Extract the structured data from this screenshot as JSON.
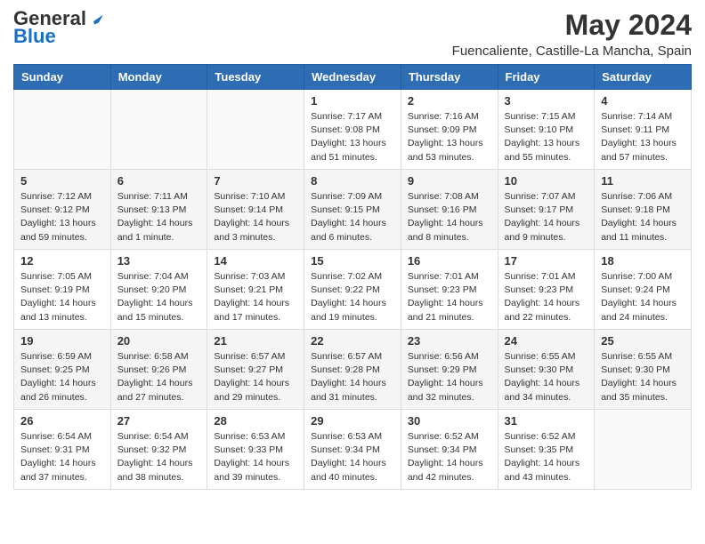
{
  "header": {
    "logo_general": "General",
    "logo_blue": "Blue",
    "title": "May 2024",
    "subtitle": "Fuencaliente, Castille-La Mancha, Spain"
  },
  "columns": [
    "Sunday",
    "Monday",
    "Tuesday",
    "Wednesday",
    "Thursday",
    "Friday",
    "Saturday"
  ],
  "weeks": [
    [
      {
        "day": "",
        "sunrise": "",
        "sunset": "",
        "daylight": ""
      },
      {
        "day": "",
        "sunrise": "",
        "sunset": "",
        "daylight": ""
      },
      {
        "day": "",
        "sunrise": "",
        "sunset": "",
        "daylight": ""
      },
      {
        "day": "1",
        "sunrise": "Sunrise: 7:17 AM",
        "sunset": "Sunset: 9:08 PM",
        "daylight": "Daylight: 13 hours and 51 minutes."
      },
      {
        "day": "2",
        "sunrise": "Sunrise: 7:16 AM",
        "sunset": "Sunset: 9:09 PM",
        "daylight": "Daylight: 13 hours and 53 minutes."
      },
      {
        "day": "3",
        "sunrise": "Sunrise: 7:15 AM",
        "sunset": "Sunset: 9:10 PM",
        "daylight": "Daylight: 13 hours and 55 minutes."
      },
      {
        "day": "4",
        "sunrise": "Sunrise: 7:14 AM",
        "sunset": "Sunset: 9:11 PM",
        "daylight": "Daylight: 13 hours and 57 minutes."
      }
    ],
    [
      {
        "day": "5",
        "sunrise": "Sunrise: 7:12 AM",
        "sunset": "Sunset: 9:12 PM",
        "daylight": "Daylight: 13 hours and 59 minutes."
      },
      {
        "day": "6",
        "sunrise": "Sunrise: 7:11 AM",
        "sunset": "Sunset: 9:13 PM",
        "daylight": "Daylight: 14 hours and 1 minute."
      },
      {
        "day": "7",
        "sunrise": "Sunrise: 7:10 AM",
        "sunset": "Sunset: 9:14 PM",
        "daylight": "Daylight: 14 hours and 3 minutes."
      },
      {
        "day": "8",
        "sunrise": "Sunrise: 7:09 AM",
        "sunset": "Sunset: 9:15 PM",
        "daylight": "Daylight: 14 hours and 6 minutes."
      },
      {
        "day": "9",
        "sunrise": "Sunrise: 7:08 AM",
        "sunset": "Sunset: 9:16 PM",
        "daylight": "Daylight: 14 hours and 8 minutes."
      },
      {
        "day": "10",
        "sunrise": "Sunrise: 7:07 AM",
        "sunset": "Sunset: 9:17 PM",
        "daylight": "Daylight: 14 hours and 9 minutes."
      },
      {
        "day": "11",
        "sunrise": "Sunrise: 7:06 AM",
        "sunset": "Sunset: 9:18 PM",
        "daylight": "Daylight: 14 hours and 11 minutes."
      }
    ],
    [
      {
        "day": "12",
        "sunrise": "Sunrise: 7:05 AM",
        "sunset": "Sunset: 9:19 PM",
        "daylight": "Daylight: 14 hours and 13 minutes."
      },
      {
        "day": "13",
        "sunrise": "Sunrise: 7:04 AM",
        "sunset": "Sunset: 9:20 PM",
        "daylight": "Daylight: 14 hours and 15 minutes."
      },
      {
        "day": "14",
        "sunrise": "Sunrise: 7:03 AM",
        "sunset": "Sunset: 9:21 PM",
        "daylight": "Daylight: 14 hours and 17 minutes."
      },
      {
        "day": "15",
        "sunrise": "Sunrise: 7:02 AM",
        "sunset": "Sunset: 9:22 PM",
        "daylight": "Daylight: 14 hours and 19 minutes."
      },
      {
        "day": "16",
        "sunrise": "Sunrise: 7:01 AM",
        "sunset": "Sunset: 9:23 PM",
        "daylight": "Daylight: 14 hours and 21 minutes."
      },
      {
        "day": "17",
        "sunrise": "Sunrise: 7:01 AM",
        "sunset": "Sunset: 9:23 PM",
        "daylight": "Daylight: 14 hours and 22 minutes."
      },
      {
        "day": "18",
        "sunrise": "Sunrise: 7:00 AM",
        "sunset": "Sunset: 9:24 PM",
        "daylight": "Daylight: 14 hours and 24 minutes."
      }
    ],
    [
      {
        "day": "19",
        "sunrise": "Sunrise: 6:59 AM",
        "sunset": "Sunset: 9:25 PM",
        "daylight": "Daylight: 14 hours and 26 minutes."
      },
      {
        "day": "20",
        "sunrise": "Sunrise: 6:58 AM",
        "sunset": "Sunset: 9:26 PM",
        "daylight": "Daylight: 14 hours and 27 minutes."
      },
      {
        "day": "21",
        "sunrise": "Sunrise: 6:57 AM",
        "sunset": "Sunset: 9:27 PM",
        "daylight": "Daylight: 14 hours and 29 minutes."
      },
      {
        "day": "22",
        "sunrise": "Sunrise: 6:57 AM",
        "sunset": "Sunset: 9:28 PM",
        "daylight": "Daylight: 14 hours and 31 minutes."
      },
      {
        "day": "23",
        "sunrise": "Sunrise: 6:56 AM",
        "sunset": "Sunset: 9:29 PM",
        "daylight": "Daylight: 14 hours and 32 minutes."
      },
      {
        "day": "24",
        "sunrise": "Sunrise: 6:55 AM",
        "sunset": "Sunset: 9:30 PM",
        "daylight": "Daylight: 14 hours and 34 minutes."
      },
      {
        "day": "25",
        "sunrise": "Sunrise: 6:55 AM",
        "sunset": "Sunset: 9:30 PM",
        "daylight": "Daylight: 14 hours and 35 minutes."
      }
    ],
    [
      {
        "day": "26",
        "sunrise": "Sunrise: 6:54 AM",
        "sunset": "Sunset: 9:31 PM",
        "daylight": "Daylight: 14 hours and 37 minutes."
      },
      {
        "day": "27",
        "sunrise": "Sunrise: 6:54 AM",
        "sunset": "Sunset: 9:32 PM",
        "daylight": "Daylight: 14 hours and 38 minutes."
      },
      {
        "day": "28",
        "sunrise": "Sunrise: 6:53 AM",
        "sunset": "Sunset: 9:33 PM",
        "daylight": "Daylight: 14 hours and 39 minutes."
      },
      {
        "day": "29",
        "sunrise": "Sunrise: 6:53 AM",
        "sunset": "Sunset: 9:34 PM",
        "daylight": "Daylight: 14 hours and 40 minutes."
      },
      {
        "day": "30",
        "sunrise": "Sunrise: 6:52 AM",
        "sunset": "Sunset: 9:34 PM",
        "daylight": "Daylight: 14 hours and 42 minutes."
      },
      {
        "day": "31",
        "sunrise": "Sunrise: 6:52 AM",
        "sunset": "Sunset: 9:35 PM",
        "daylight": "Daylight: 14 hours and 43 minutes."
      },
      {
        "day": "",
        "sunrise": "",
        "sunset": "",
        "daylight": ""
      }
    ]
  ]
}
